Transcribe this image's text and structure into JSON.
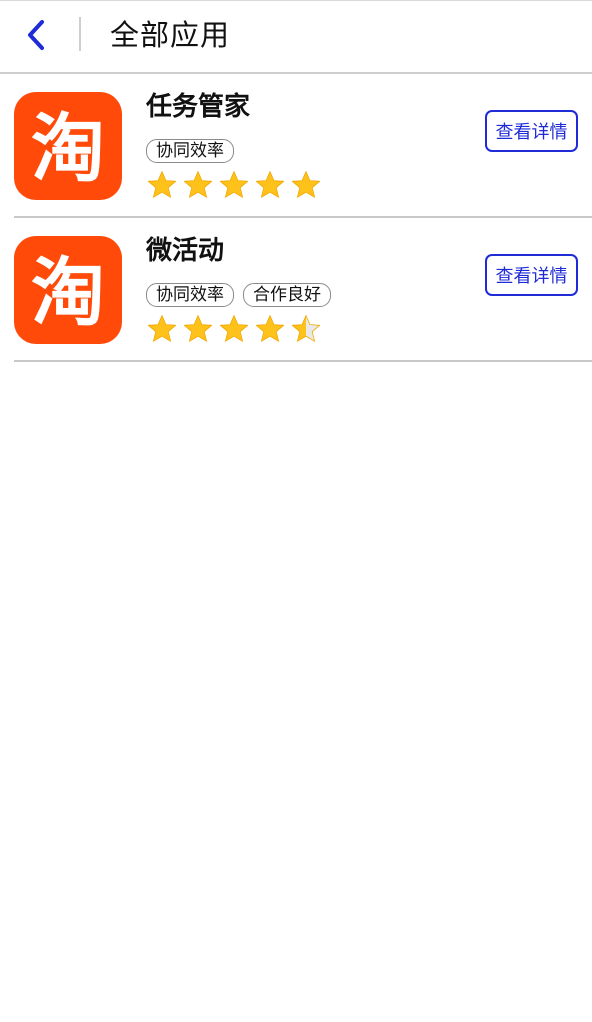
{
  "header": {
    "back_icon": "chevron-left-icon",
    "title": "全部应用"
  },
  "colors": {
    "accent": "#1e2bd6",
    "icon_bg": "#ff4a0a",
    "star": "#ffc21a",
    "star_empty": "#e9e9e9"
  },
  "apps": [
    {
      "name": "任务管家",
      "icon_glyph": "淘",
      "tags": [
        "协同效率"
      ],
      "rating": 5,
      "detail_label": "查看详情"
    },
    {
      "name": "微活动",
      "icon_glyph": "淘",
      "tags": [
        "协同效率",
        "合作良好"
      ],
      "rating": 4.5,
      "detail_label": "查看详情"
    }
  ]
}
